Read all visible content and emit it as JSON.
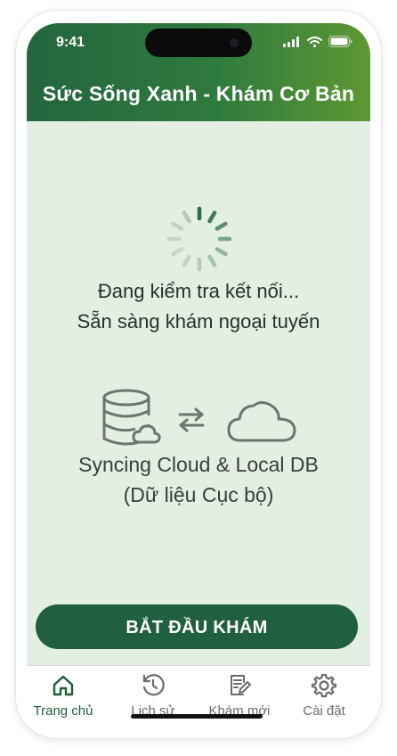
{
  "status_bar": {
    "time": "9:41",
    "icons": [
      "signal-icon",
      "wifi-icon",
      "battery-icon"
    ]
  },
  "header": {
    "title": "Sức Sống Xanh - Khám Cơ Bản"
  },
  "loading": {
    "line1": "Đang kiểm tra kết nối...",
    "line2": "Sẵn sàng khám ngoại tuyến"
  },
  "sync": {
    "icons": [
      "database-cloud-icon",
      "sync-arrows-icon",
      "cloud-icon"
    ],
    "line1": "Syncing Cloud & Local DB",
    "line2": "(Dữ liệu Cục bộ)"
  },
  "primary_action": {
    "label": "BẮT ĐẦU KHÁM"
  },
  "tabs": [
    {
      "label": "Trang chủ",
      "icon": "home-icon",
      "active": true
    },
    {
      "label": "Lịch sử",
      "icon": "history-icon",
      "active": false
    },
    {
      "label": "Khám mới",
      "icon": "new-exam-icon",
      "active": false
    },
    {
      "label": "Cài đặt",
      "icon": "gear-icon",
      "active": false
    }
  ],
  "colors": {
    "header_start": "#23663f",
    "header_end": "#5d9832",
    "background": "#e2efe2",
    "button": "#20603e",
    "active_tab": "#1f5f3a",
    "inactive_tab": "#6b6b6b"
  }
}
